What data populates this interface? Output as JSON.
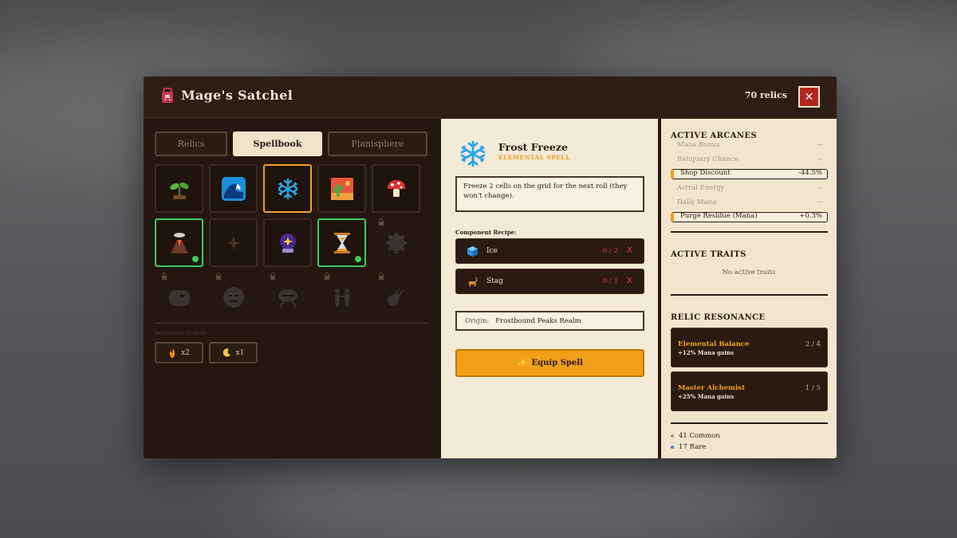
{
  "header": {
    "title": "Mage's Satchel",
    "relic_count": "70 relics",
    "close_label": "✕"
  },
  "tabs": [
    {
      "label": "Relics",
      "active": false
    },
    {
      "label": "Spellbook",
      "active": true
    },
    {
      "label": "Planisphere",
      "active": false
    }
  ],
  "grid": {
    "rows": [
      [
        {
          "icon": "seedling-icon",
          "state": "normal"
        },
        {
          "icon": "wave-icon",
          "state": "normal"
        },
        {
          "icon": "snowflake-icon",
          "state": "selected"
        },
        {
          "icon": "desert-icon",
          "state": "normal"
        },
        {
          "icon": "mushroom-icon",
          "state": "normal"
        }
      ],
      [
        {
          "icon": "volcano-icon",
          "state": "owned"
        },
        {
          "icon": "sparkle-icon",
          "state": "dim"
        },
        {
          "icon": "crystal-ball-icon",
          "state": "normal"
        },
        {
          "icon": "hourglass-icon",
          "state": "owned"
        },
        {
          "icon": "gear-silhouette-icon",
          "state": "locked"
        }
      ],
      [
        {
          "icon": "whale-silhouette-icon",
          "state": "locked"
        },
        {
          "icon": "moai-silhouette-icon",
          "state": "locked"
        },
        {
          "icon": "brazier-silhouette-icon",
          "state": "locked"
        },
        {
          "icon": "dancers-silhouette-icon",
          "state": "locked"
        },
        {
          "icon": "comet-silhouette-icon",
          "state": "locked"
        }
      ]
    ]
  },
  "ingredients": {
    "label": "Ingredient Collect",
    "items": [
      {
        "icon": "fire-icon",
        "count": "x2"
      },
      {
        "icon": "moon-icon",
        "count": "x1"
      }
    ]
  },
  "spell": {
    "name": "Frost Freeze",
    "type": "ELEMENTAL SPELL",
    "description": "Freeze 2 cells on the grid for the next roll (they won't change).",
    "recipe_label": "Component Recipe:",
    "components": [
      {
        "icon": "ice-cube-icon",
        "name": "Ice",
        "qty": "0 / 2",
        "status": "X"
      },
      {
        "icon": "stag-icon",
        "name": "Stag",
        "qty": "0 / 1",
        "status": "X"
      }
    ],
    "origin_label": "Origin:",
    "origin_value": "Frostbound Peaks Realm",
    "equip_label": "Equip Spell",
    "equip_glyph": "✨"
  },
  "arcanes": {
    "title": "ACTIVE ARCANES",
    "rows": [
      {
        "name": "Mana Bonus",
        "value": "—",
        "highlight": false
      },
      {
        "name": "Reliquary Chance",
        "value": "—",
        "highlight": false
      },
      {
        "name": "Shop Discount",
        "value": "-44.5%",
        "highlight": true
      },
      {
        "name": "Astral Energy",
        "value": "—",
        "highlight": false
      },
      {
        "name": "Daily Mana",
        "value": "—",
        "highlight": false
      },
      {
        "name": "Purge Residue (Mana)",
        "value": "+0.3%",
        "highlight": true
      }
    ]
  },
  "traits": {
    "title": "ACTIVE TRAITS",
    "empty": "No active traits"
  },
  "resonance": {
    "title": "RELIC RESONANCE",
    "items": [
      {
        "name": "Elemental Balance",
        "desc": "+12% Mana gains",
        "count": "2 / 4"
      },
      {
        "name": "Master Alchemist",
        "desc": "+25% Mana gains",
        "count": "1 / 5"
      }
    ]
  },
  "rarity": [
    {
      "label": "41 Common",
      "color": "#9a8c7a"
    },
    {
      "label": "17 Rare",
      "color": "#4a7bd8"
    }
  ],
  "colors": {
    "accent": "#f2a019",
    "selected_border": "#f2a122",
    "owned_border": "#3ccc5a",
    "danger": "#e23a33"
  }
}
